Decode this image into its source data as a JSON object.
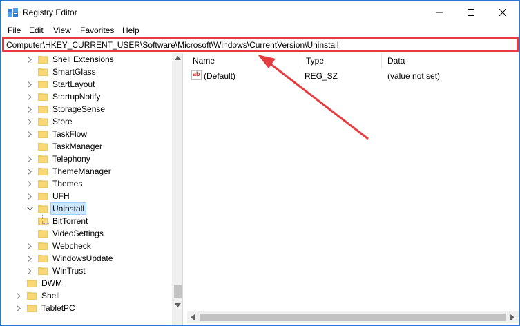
{
  "window": {
    "title": "Registry Editor"
  },
  "menu": [
    "File",
    "Edit",
    "View",
    "Favorites",
    "Help"
  ],
  "address": "Computer\\HKEY_CURRENT_USER\\Software\\Microsoft\\Windows\\CurrentVersion\\Uninstall",
  "tree": {
    "items": [
      {
        "label": "Shell Extensions",
        "expandable": true
      },
      {
        "label": "SmartGlass",
        "expandable": false
      },
      {
        "label": "StartLayout",
        "expandable": true
      },
      {
        "label": "StartupNotify",
        "expandable": true
      },
      {
        "label": "StorageSense",
        "expandable": true
      },
      {
        "label": "Store",
        "expandable": true
      },
      {
        "label": "TaskFlow",
        "expandable": true
      },
      {
        "label": "TaskManager",
        "expandable": false
      },
      {
        "label": "Telephony",
        "expandable": true
      },
      {
        "label": "ThemeManager",
        "expandable": true
      },
      {
        "label": "Themes",
        "expandable": true
      },
      {
        "label": "UFH",
        "expandable": true
      },
      {
        "label": "Uninstall",
        "expanded": true,
        "selected": true
      },
      {
        "label": "BitTorrent",
        "child": true
      },
      {
        "label": "VideoSettings",
        "expandable": false
      },
      {
        "label": "Webcheck",
        "expandable": true
      },
      {
        "label": "WindowsUpdate",
        "expandable": true
      },
      {
        "label": "WinTrust",
        "expandable": true
      },
      {
        "label": "DWM",
        "level": "upper",
        "expandable": false
      },
      {
        "label": "Shell",
        "level": "upper",
        "expandable": true
      },
      {
        "label": "TabletPC",
        "level": "upper",
        "expandable": true
      }
    ]
  },
  "list": {
    "columns": [
      "Name",
      "Type",
      "Data"
    ],
    "rows": [
      {
        "name": "(Default)",
        "type": "REG_SZ",
        "data": "(value not set)",
        "icon": "string-value-icon"
      }
    ]
  },
  "colors": {
    "highlight": "#e63b3f",
    "folder": "#f8d775",
    "selection": "#cce8ff"
  }
}
